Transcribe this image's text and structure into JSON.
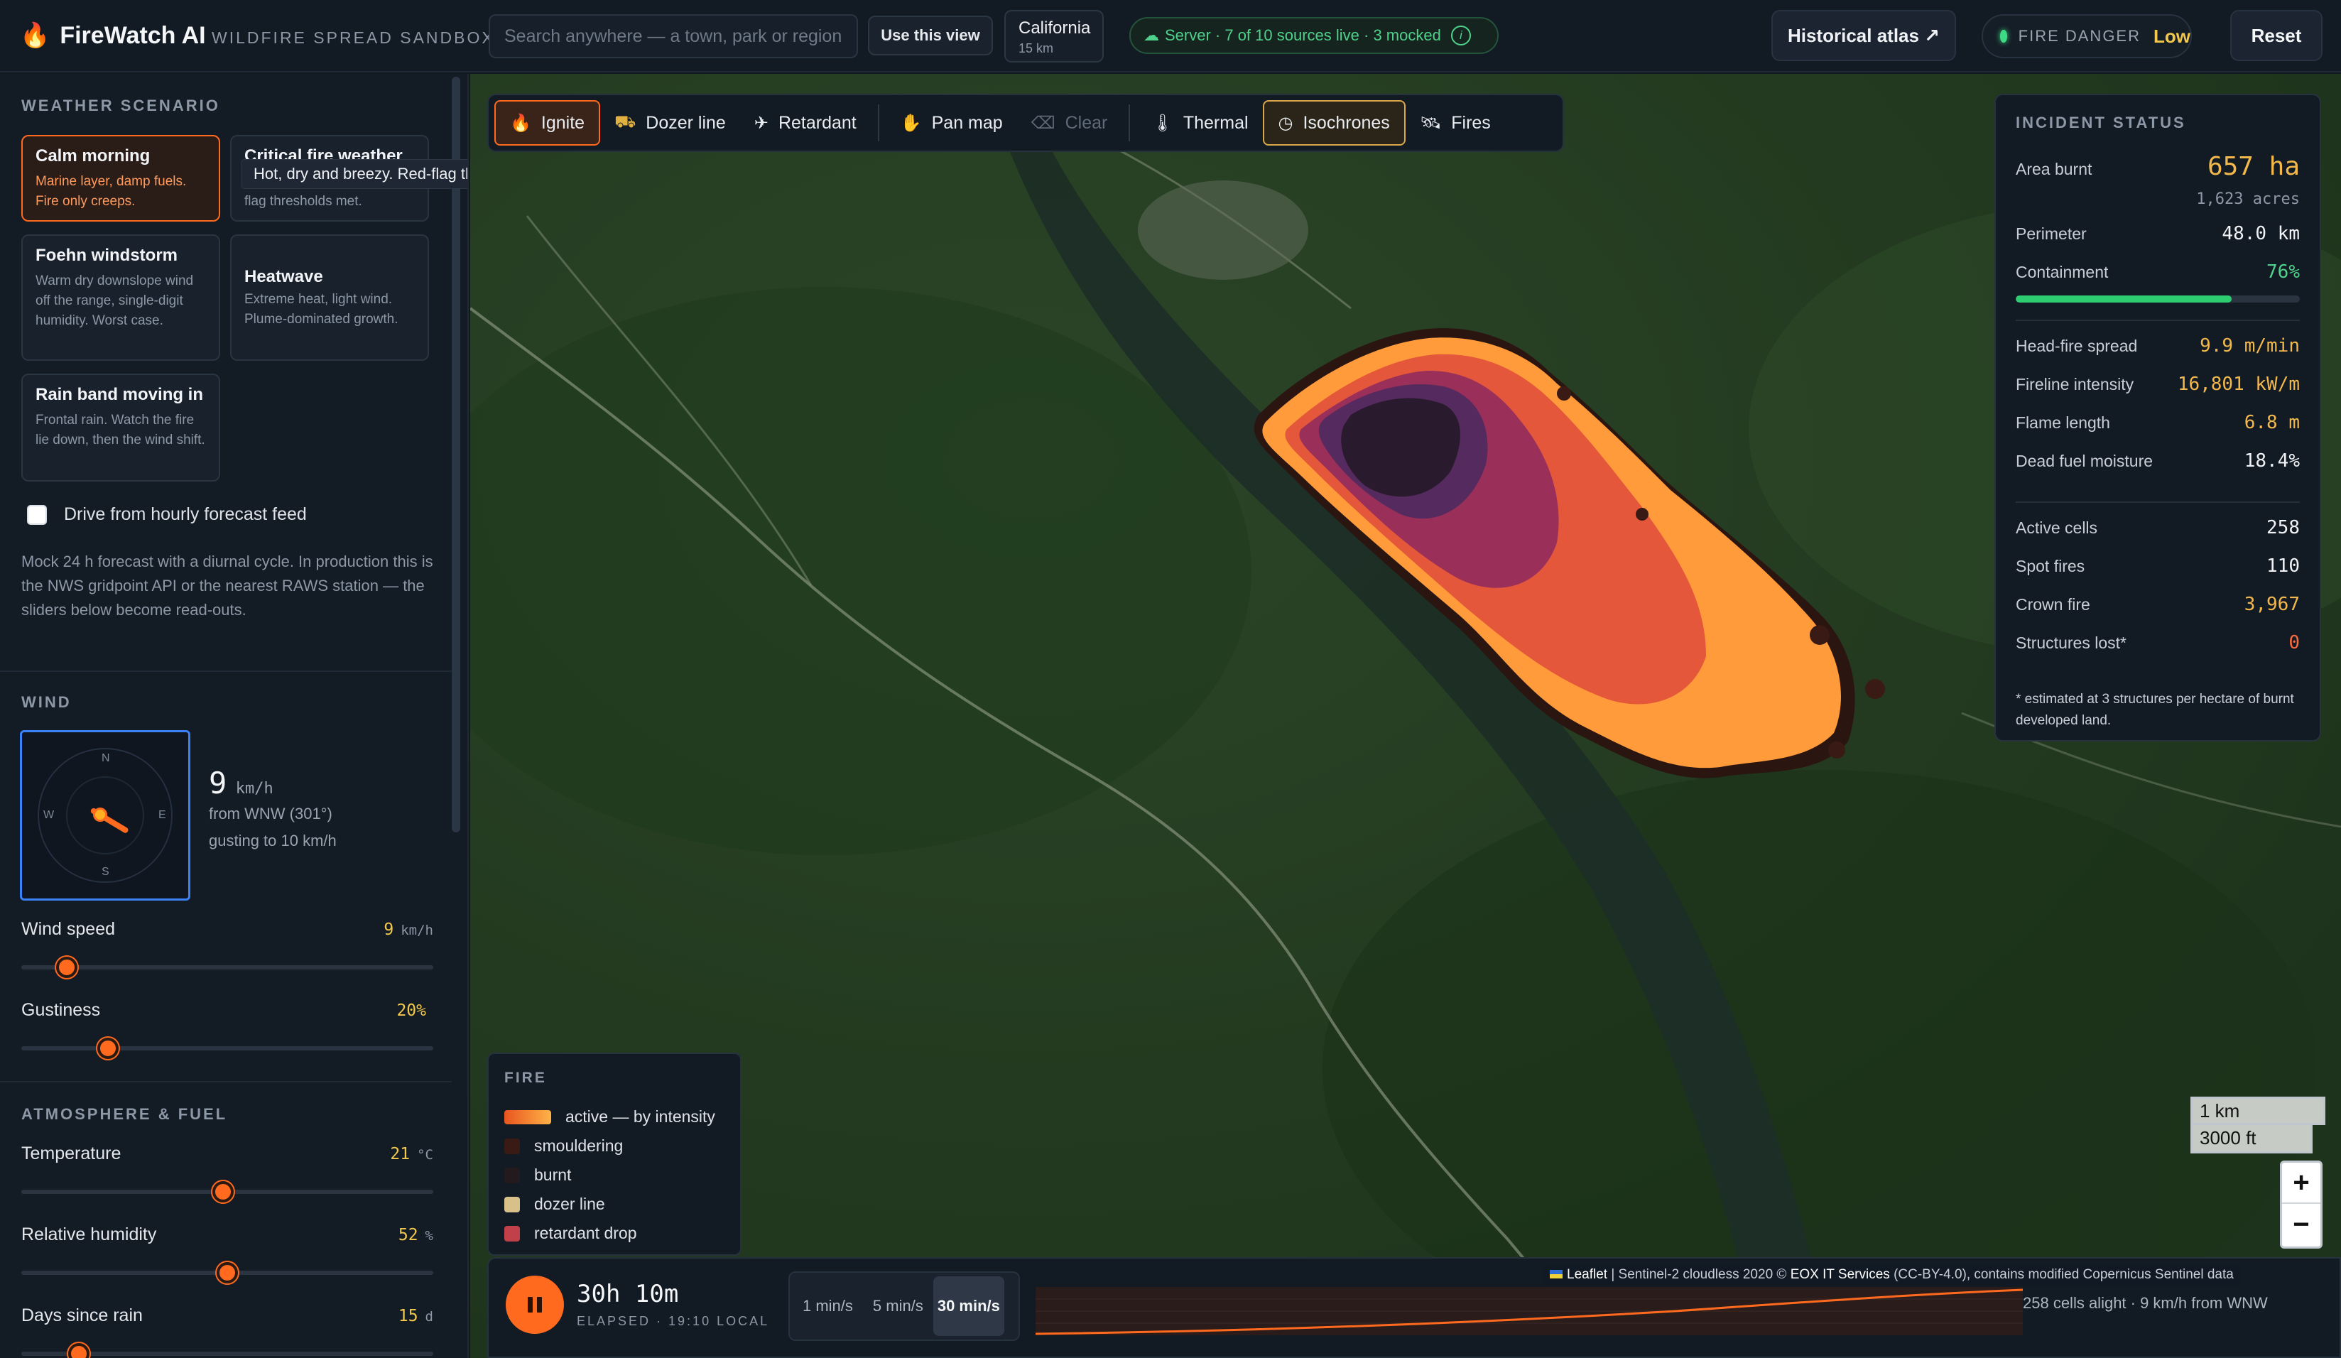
{
  "app": {
    "name": "FireWatch AI",
    "subtitle": "WILDFIRE SPREAD SANDBOX",
    "brand_icon": "flame-icon"
  },
  "header": {
    "search_placeholder": "Search anywhere — a town, park or region",
    "use_view_label": "Use this view",
    "region_name": "California",
    "region_range": "15 km",
    "server_status": "Server · 7 of 10 sources live · 3 mocked",
    "server_info_glyph": "i",
    "atlas_label": "Historical atlas ↗",
    "danger_label": "FIRE DANGER",
    "danger_value": "Low",
    "reset_label": "Reset"
  },
  "sidebar": {
    "scenario_title": "WEATHER SCENARIO",
    "scenarios": [
      {
        "title": "Calm morning",
        "desc": "Marine layer, damp fuels. Fire only creeps."
      },
      {
        "title": "Critical fire weather",
        "desc": "Hot, dry and breezy. Red-flag thresholds met."
      },
      {
        "title": "Foehn windstorm",
        "desc": "Warm dry downslope wind off the range, single-digit humidity. Worst case."
      },
      {
        "title": "Heatwave",
        "desc": "Extreme heat, light wind. Plume-dominated growth."
      },
      {
        "title": "Rain band moving in",
        "desc": "Frontal rain. Watch the fire lie down, then the wind shift."
      }
    ],
    "tooltip": "Hot, dry and breezy. Red-flag thresholds met.",
    "forecast_label": "Drive from hourly forecast feed",
    "forecast_checked": false,
    "forecast_note": "Mock 24 h forecast with a diurnal cycle. In production this is the NWS gridpoint API or the nearest RAWS station — the sliders below become read-outs.",
    "wind_title": "WIND",
    "compass": {
      "n": "N",
      "e": "E",
      "s": "S",
      "w": "W"
    },
    "wind_speed_value": "9",
    "wind_speed_unit": "km/h",
    "wind_from": "from WNW (301°)",
    "wind_gust": "gusting to 10 km/h",
    "sliders_wind": [
      {
        "label": "Wind speed",
        "value": "9",
        "unit": "km/h",
        "fraction": 0.11
      },
      {
        "label": "Gustiness",
        "value": "20%",
        "unit": "",
        "fraction": 0.21
      }
    ],
    "atmos_title": "ATMOSPHERE & FUEL",
    "sliders_atmos": [
      {
        "label": "Temperature",
        "value": "21",
        "unit": "°C",
        "fraction": 0.49
      },
      {
        "label": "Relative humidity",
        "value": "52",
        "unit": "%",
        "fraction": 0.5
      },
      {
        "label": "Days since rain",
        "value": "15",
        "unit": "d",
        "fraction": 0.14
      }
    ]
  },
  "toolbar": {
    "tools": [
      {
        "label": "Ignite",
        "icon": "flame-icon",
        "glyph": "🔥",
        "state": "active"
      },
      {
        "label": "Dozer line",
        "icon": "bulldozer-icon",
        "glyph": "⛟",
        "state": "normal"
      },
      {
        "label": "Retardant",
        "icon": "plane-icon",
        "glyph": "✈",
        "state": "normal"
      },
      {
        "label": "Pan map",
        "icon": "hand-icon",
        "glyph": "✋",
        "state": "normal"
      },
      {
        "label": "Clear",
        "icon": "eraser-icon",
        "glyph": "⌫",
        "state": "disabled"
      },
      {
        "label": "Thermal",
        "icon": "thermometer-icon",
        "glyph": "🌡",
        "state": "normal"
      },
      {
        "label": "Isochrones",
        "icon": "clock-icon",
        "glyph": "◷",
        "state": "toggled"
      },
      {
        "label": "Fires",
        "icon": "satellite-icon",
        "glyph": "🛰",
        "state": "normal"
      }
    ]
  },
  "incident": {
    "title": "INCIDENT STATUS",
    "area_label": "Area burnt",
    "area_value": "657 ha",
    "area_acres": "1,623 acres",
    "perimeter_label": "Perimeter",
    "perimeter_value": "48.0 km",
    "containment_label": "Containment",
    "containment_value": "76%",
    "containment_fraction": 0.76,
    "metrics": [
      {
        "label": "Head-fire spread",
        "value": "9.9 m/min"
      },
      {
        "label": "Fireline intensity",
        "value": "16,801 kW/m"
      },
      {
        "label": "Flame length",
        "value": "6.8 m"
      },
      {
        "label": "Dead fuel moisture",
        "value": "18.4%"
      }
    ],
    "counts": [
      {
        "label": "Active cells",
        "value": "258"
      },
      {
        "label": "Spot fires",
        "value": "110"
      },
      {
        "label": "Crown fire",
        "value": "3,967"
      },
      {
        "label": "Structures lost*",
        "value": "0"
      }
    ],
    "footnote": "* estimated at 3 structures per hectare of burnt developed land."
  },
  "legend": {
    "title": "FIRE",
    "items": [
      {
        "label": "active — by intensity",
        "color": "#ff8a2a"
      },
      {
        "label": "smouldering",
        "color": "#3a1a14"
      },
      {
        "label": "burnt",
        "color": "#221a1c"
      },
      {
        "label": "dozer line",
        "color": "#d8c08a"
      },
      {
        "label": "retardant drop",
        "color": "#c2404a"
      }
    ]
  },
  "playbar": {
    "elapsed": "30h 10m",
    "elapsed_sub": "ELAPSED · 19:10 LOCAL",
    "speeds": [
      "1 min/s",
      "5 min/s",
      "30 min/s"
    ],
    "selected_speed": "30 min/s",
    "status": "258 cells alight · 9 km/h from WNW"
  },
  "map": {
    "attribution_leaflet": "Leaflet",
    "attribution_text": " | Sentinel-2 cloudless 2020 © ",
    "attribution_eox": "EOX IT Services",
    "attribution_rest": " (CC-BY-4.0), contains modified Copernicus Sentinel data",
    "scale_km": "1 km",
    "scale_ft": "3000 ft",
    "zoom_in": "+",
    "zoom_out": "−"
  },
  "colors": {
    "accent": "#ff6a1f",
    "ok": "#4fd18b",
    "warn": "#f2c94c"
  }
}
